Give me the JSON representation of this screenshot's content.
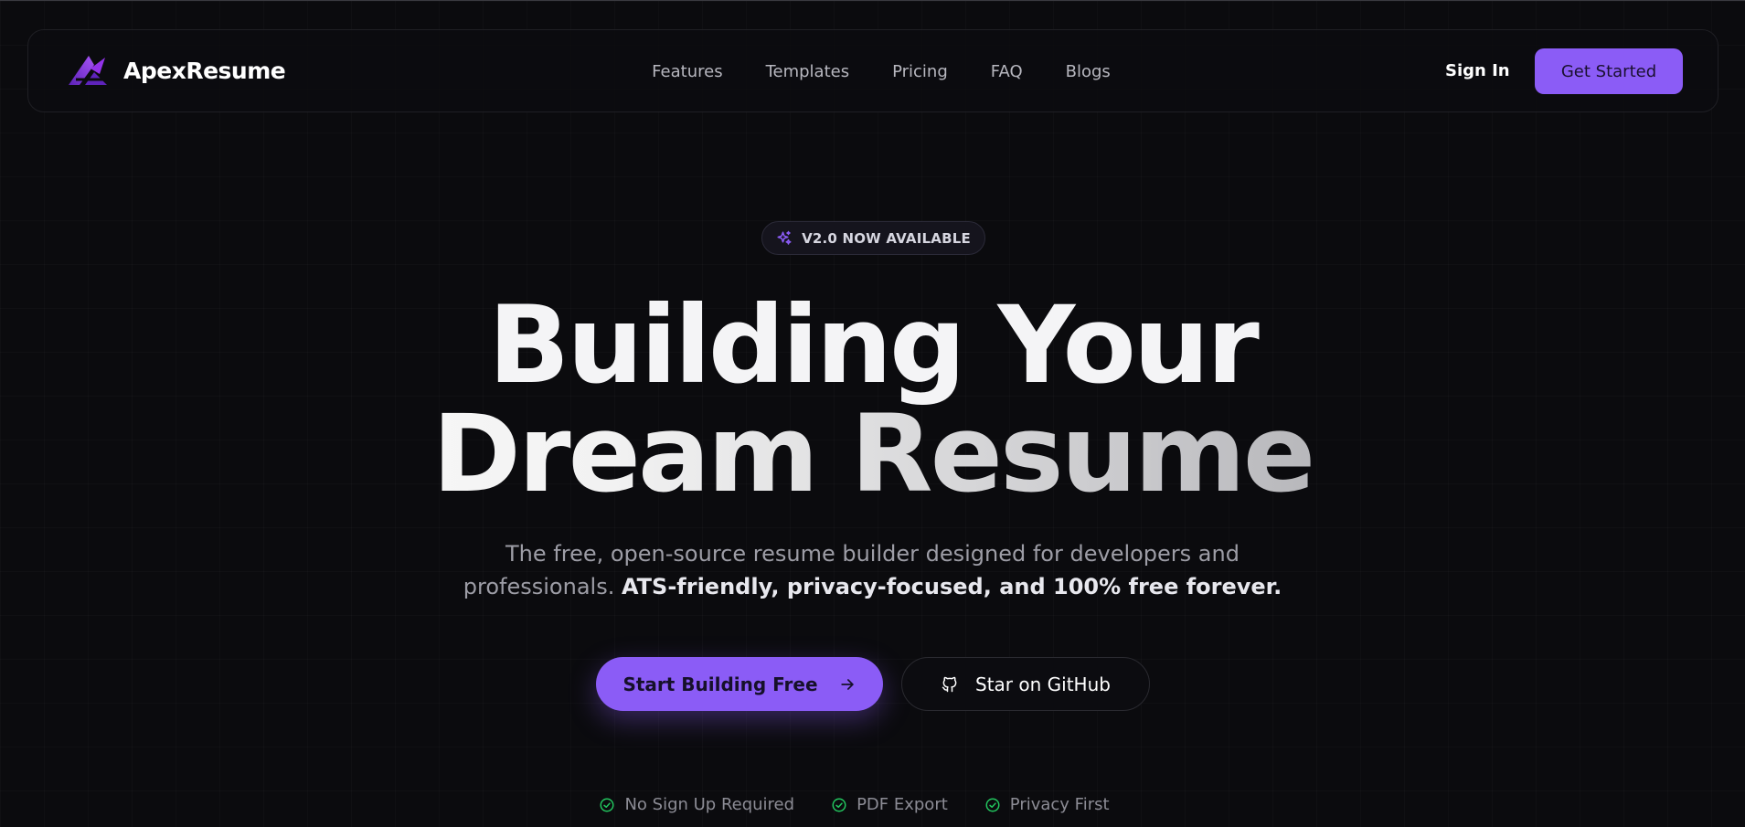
{
  "brand": {
    "name": "ApexResume",
    "logo_icon": "apex-logo-icon"
  },
  "nav": {
    "links": [
      {
        "label": "Features"
      },
      {
        "label": "Templates"
      },
      {
        "label": "Pricing"
      },
      {
        "label": "FAQ"
      },
      {
        "label": "Blogs"
      }
    ],
    "signin_label": "Sign In",
    "get_started_label": "Get Started"
  },
  "hero": {
    "badge_icon": "sparkle-icon",
    "badge_text": "V2.0 NOW AVAILABLE",
    "headline_line1": "Building Your",
    "headline_line2": "Dream Resume",
    "subtitle_line1": "The free, open-source resume builder designed for developers and",
    "subtitle_line2_plain": "professionals. ",
    "subtitle_line2_highlight": "ATS-friendly, privacy-focused, and 100% free forever.",
    "primary_cta": "Start Building Free",
    "primary_cta_icon": "arrow-right-icon",
    "secondary_cta": "Star on GitHub",
    "secondary_cta_icon": "github-icon"
  },
  "features": [
    {
      "label": "No Sign Up Required",
      "icon": "check-circle-icon"
    },
    {
      "label": "PDF Export",
      "icon": "check-circle-icon"
    },
    {
      "label": "Privacy First",
      "icon": "check-circle-icon"
    }
  ],
  "colors": {
    "background": "#0b0b0e",
    "accent": "#8b5cf6",
    "success": "#22c55e",
    "text_muted": "#9d9da6"
  }
}
